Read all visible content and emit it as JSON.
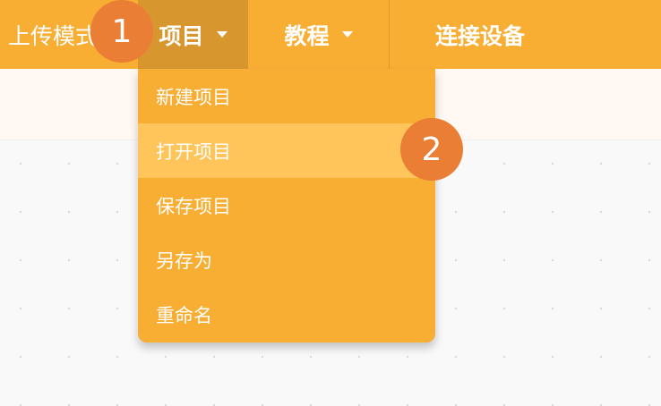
{
  "menubar": {
    "upload_label": "上传模式",
    "project_label": "项目",
    "tutorial_label": "教程",
    "connect_label": "连接设备"
  },
  "project_menu": {
    "items": [
      {
        "label": "新建项目"
      },
      {
        "label": "打开项目"
      },
      {
        "label": "保存项目"
      },
      {
        "label": "另存为"
      },
      {
        "label": "重命名"
      }
    ],
    "highlighted_index": 1
  },
  "annotations": {
    "step1": "1",
    "step2": "2"
  },
  "colors": {
    "menubar_bg": "#f8ad33",
    "active_menu_bg": "#d8962f",
    "highlight_bg": "#ffc55a",
    "badge_bg": "#ea7e35"
  },
  "icons": {
    "caret": "chevron-down-icon"
  }
}
